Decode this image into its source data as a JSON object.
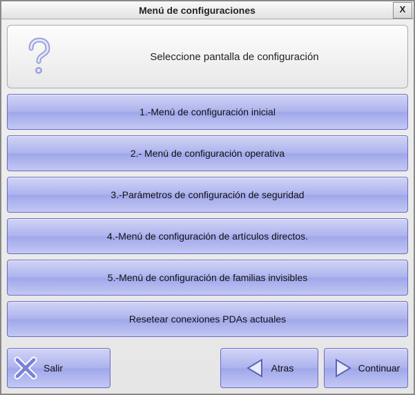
{
  "window": {
    "title": "Menú de configuraciones",
    "close_label": "X"
  },
  "prompt": {
    "text": "Seleccione pantalla de configuración"
  },
  "menu": {
    "items": [
      {
        "label": "1.-Menú de configuración inicial"
      },
      {
        "label": "2.- Menú de configuración operativa"
      },
      {
        "label": "3.-Parámetros de configuración de seguridad"
      },
      {
        "label": "4.-Menú de configuración de artículos directos."
      },
      {
        "label": "5.-Menú de configuración de familias invisibles"
      },
      {
        "label": "Resetear conexiones PDAs actuales"
      }
    ]
  },
  "footer": {
    "exit_label": "Salir",
    "back_label": "Atras",
    "continue_label": "Continuar"
  }
}
